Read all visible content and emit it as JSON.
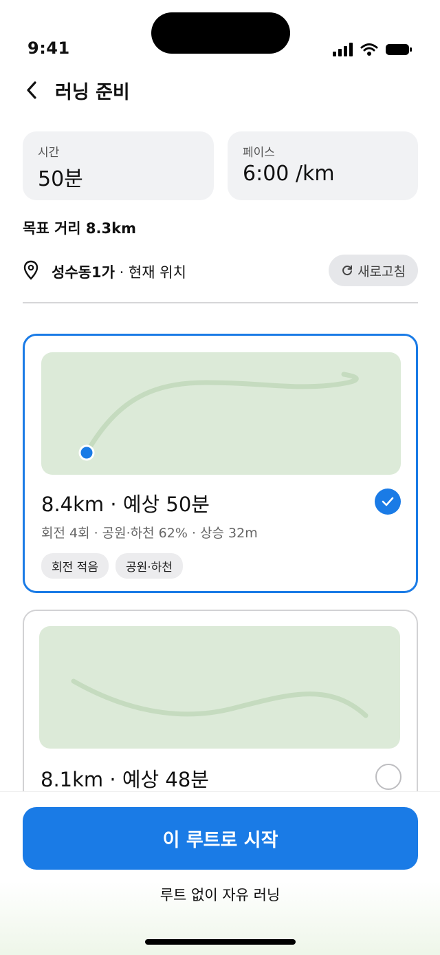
{
  "status": {
    "time": "9:41"
  },
  "nav": {
    "title": "러닝 준비"
  },
  "stats": [
    {
      "label": "시간",
      "value": "50분"
    },
    {
      "label": "페이스",
      "value": "6:00 /km"
    }
  ],
  "target_distance": "목표 거리 8.3km",
  "location": {
    "name": "성수동1가",
    "suffix": " · 현재 위치",
    "refresh_label": "새로고침"
  },
  "routes": [
    {
      "title": "8.4km · 예상 50분",
      "meta": "회전 4회 · 공원·하천 62% · 상승 32m",
      "tags": [
        "회전 적음",
        "공원·하천"
      ],
      "selected": true
    },
    {
      "title": "8.1km · 예상 48분",
      "selected": false
    }
  ],
  "actions": {
    "start_label": "이 루트로 시작",
    "free_label": "루트 없이 자유 러닝"
  },
  "colors": {
    "accent": "#1a7be6",
    "map_bg": "#dcead8",
    "route_line": "#c5dbbf"
  },
  "icons": [
    "back-chevron-icon",
    "location-pin-icon",
    "refresh-icon",
    "checkmark-icon",
    "signal-icon",
    "wifi-icon",
    "battery-icon"
  ]
}
